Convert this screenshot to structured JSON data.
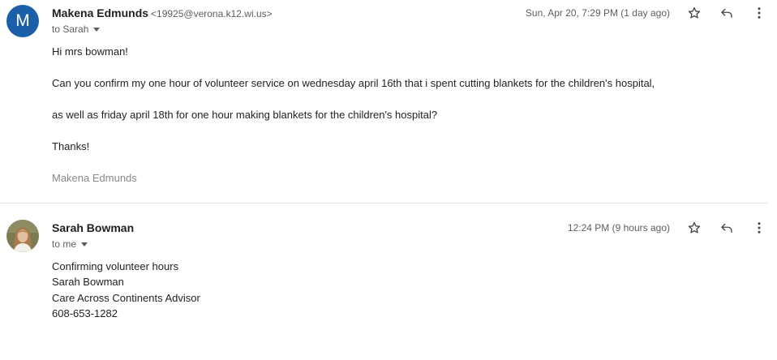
{
  "messages": [
    {
      "sender_name": "Makena Edmunds",
      "sender_email": "<19925@verona.k12.wi.us>",
      "avatar_letter": "M",
      "to": "to Sarah",
      "date": "Sun, Apr 20, 7:29 PM (1 day ago)",
      "body": [
        "Hi mrs bowman!",
        "Can you confirm my one hour of volunteer service on wednesday april 16th that i spent cutting blankets for the children's hospital,",
        "as well as friday april 18th for one hour making blankets for the children's hospital?",
        "Thanks!"
      ],
      "signature": "Makena Edmunds"
    },
    {
      "sender_name": "Sarah Bowman",
      "to": "to me",
      "date": "12:24 PM (9 hours ago)",
      "body": [
        "Confirming volunteer hours",
        "Sarah Bowman",
        "Care Across Continents Advisor",
        "608-653-1282"
      ]
    }
  ],
  "icons": {
    "star": "star-icon",
    "reply": "reply-icon",
    "more": "more-vert-icon"
  },
  "colors": {
    "avatar_bg": "#1a5fa8",
    "secondary_text": "#5e5e5e",
    "signature_text": "#888888"
  }
}
